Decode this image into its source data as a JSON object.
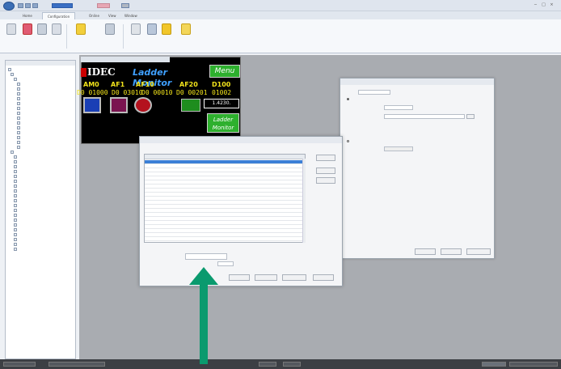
{
  "colors": {
    "accent": "#0a9a6e",
    "screen_bg": "#000000",
    "menu_green": "#2eb02e",
    "device_yellow": "#f3e41b",
    "selection": "#3b7fd6"
  },
  "ribbon": {
    "tabs": [
      "Home",
      "Configuration",
      "Online",
      "View",
      "Window"
    ],
    "buttons": [
      {
        "icon": "system-setup-icon"
      },
      {
        "icon": "object-icon"
      },
      {
        "icon": "project-icon"
      },
      {
        "icon": "download-icon"
      },
      {
        "icon": "help-icon"
      },
      {
        "icon": "transfer-icon"
      },
      {
        "icon": "monitor-icon"
      },
      {
        "icon": "zoom-icon"
      },
      {
        "icon": "settings-icon"
      },
      {
        "icon": "table-icon"
      }
    ]
  },
  "screen": {
    "logo": "IDEC",
    "title": "Ladder Monitor",
    "menu_label": "Menu",
    "devices": [
      {
        "label": "AM0",
        "value": "D0 01000"
      },
      {
        "label": "AF1",
        "value": "D0 03010"
      },
      {
        "label": "AF10",
        "value": "D0 00010"
      },
      {
        "label": "AF20",
        "value": "D0 00201"
      },
      {
        "label": "D100",
        "value": "01002"
      }
    ],
    "box_value": "1.4230.",
    "ladder_label": "Ladder Monitor"
  },
  "arrow": {
    "color": "#0a9a6e"
  }
}
